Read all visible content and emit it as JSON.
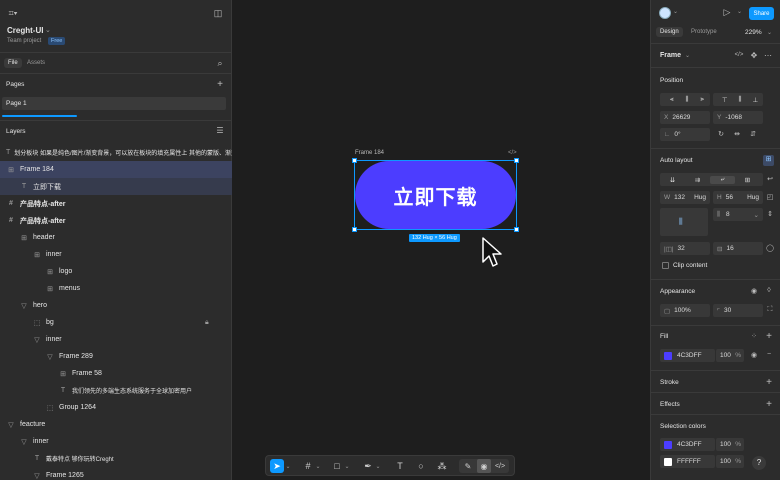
{
  "left": {
    "file_name": "Creght-UI",
    "team": "Team project",
    "plan_badge": "Free",
    "tabs": {
      "file": "File",
      "assets": "Assets"
    },
    "pages_title": "Pages",
    "page1": "Page 1",
    "layers_title": "Layers",
    "layers": [
      {
        "icon": "T",
        "label": "划分板块 如果是纯色/图片/渐变背景，可以放在板块的填充属性上 其他的蒙版、渐变..."
      },
      {
        "icon": "⊞",
        "label": "Frame 184"
      },
      {
        "icon": "T",
        "label": "立即下载"
      },
      {
        "icon": "#",
        "label": "产品特点-after"
      },
      {
        "icon": "#",
        "label": "产品特点-after"
      },
      {
        "icon": "⊞",
        "label": "header"
      },
      {
        "icon": "⊞",
        "label": "inner"
      },
      {
        "icon": "⊞",
        "label": "logo"
      },
      {
        "icon": "⊞",
        "label": "menus"
      },
      {
        "icon": "▽",
        "label": "hero"
      },
      {
        "icon": "⬚",
        "label": "bg"
      },
      {
        "icon": "▽",
        "label": "inner"
      },
      {
        "icon": "▽",
        "label": "Frame 289"
      },
      {
        "icon": "⊞",
        "label": "Frame 58"
      },
      {
        "icon": "T",
        "label": "我们领先的多端生态系统服务于全球加密用户"
      },
      {
        "icon": "⬚",
        "label": "Group 1264"
      },
      {
        "icon": "▽",
        "label": "feacture"
      },
      {
        "icon": "▽",
        "label": "inner"
      },
      {
        "icon": "T",
        "label": "戴泰特点 够你玩转Creght"
      },
      {
        "icon": "▽",
        "label": "Frame 1265"
      }
    ]
  },
  "canvas": {
    "frame_label": "Frame 184",
    "code_icon": "</>",
    "button_text": "立即下载",
    "size_badge": "132 Hug × 56 Hug"
  },
  "right": {
    "tabs": {
      "design": "Design",
      "prototype": "Prototype"
    },
    "zoom": "229%",
    "share": "Share",
    "frame_select": "Frame",
    "position_title": "Position",
    "x_label": "X",
    "x_value": "26629",
    "y_label": "Y",
    "y_value": "-1068",
    "rot_label": "∟",
    "rot_value": "0°",
    "auto_layout_title": "Auto layout",
    "w_label": "W",
    "w_value": "132",
    "w_mode": "Hug",
    "h_label": "H",
    "h_value": "56",
    "h_mode": "Hug",
    "gap_value": "8",
    "pad_h": "32",
    "pad_v": "16",
    "clip_content": "Clip content",
    "appearance_title": "Appearance",
    "opacity": "100%",
    "radius": "30",
    "fill_title": "Fill",
    "fill_hex": "4C3DFF",
    "fill_opacity": "100",
    "pct": "%",
    "stroke_title": "Stroke",
    "effects_title": "Effects",
    "selection_colors_title": "Selection colors",
    "sel_colors": [
      {
        "hex": "4C3DFF",
        "opacity": "100"
      },
      {
        "hex": "FFFFFF",
        "opacity": "100"
      }
    ],
    "help": "?"
  },
  "colors": {
    "accent": "#0d99ff",
    "button_fill": "#4C3DFF",
    "white": "#FFFFFF",
    "selection_row": "#3c4360"
  }
}
